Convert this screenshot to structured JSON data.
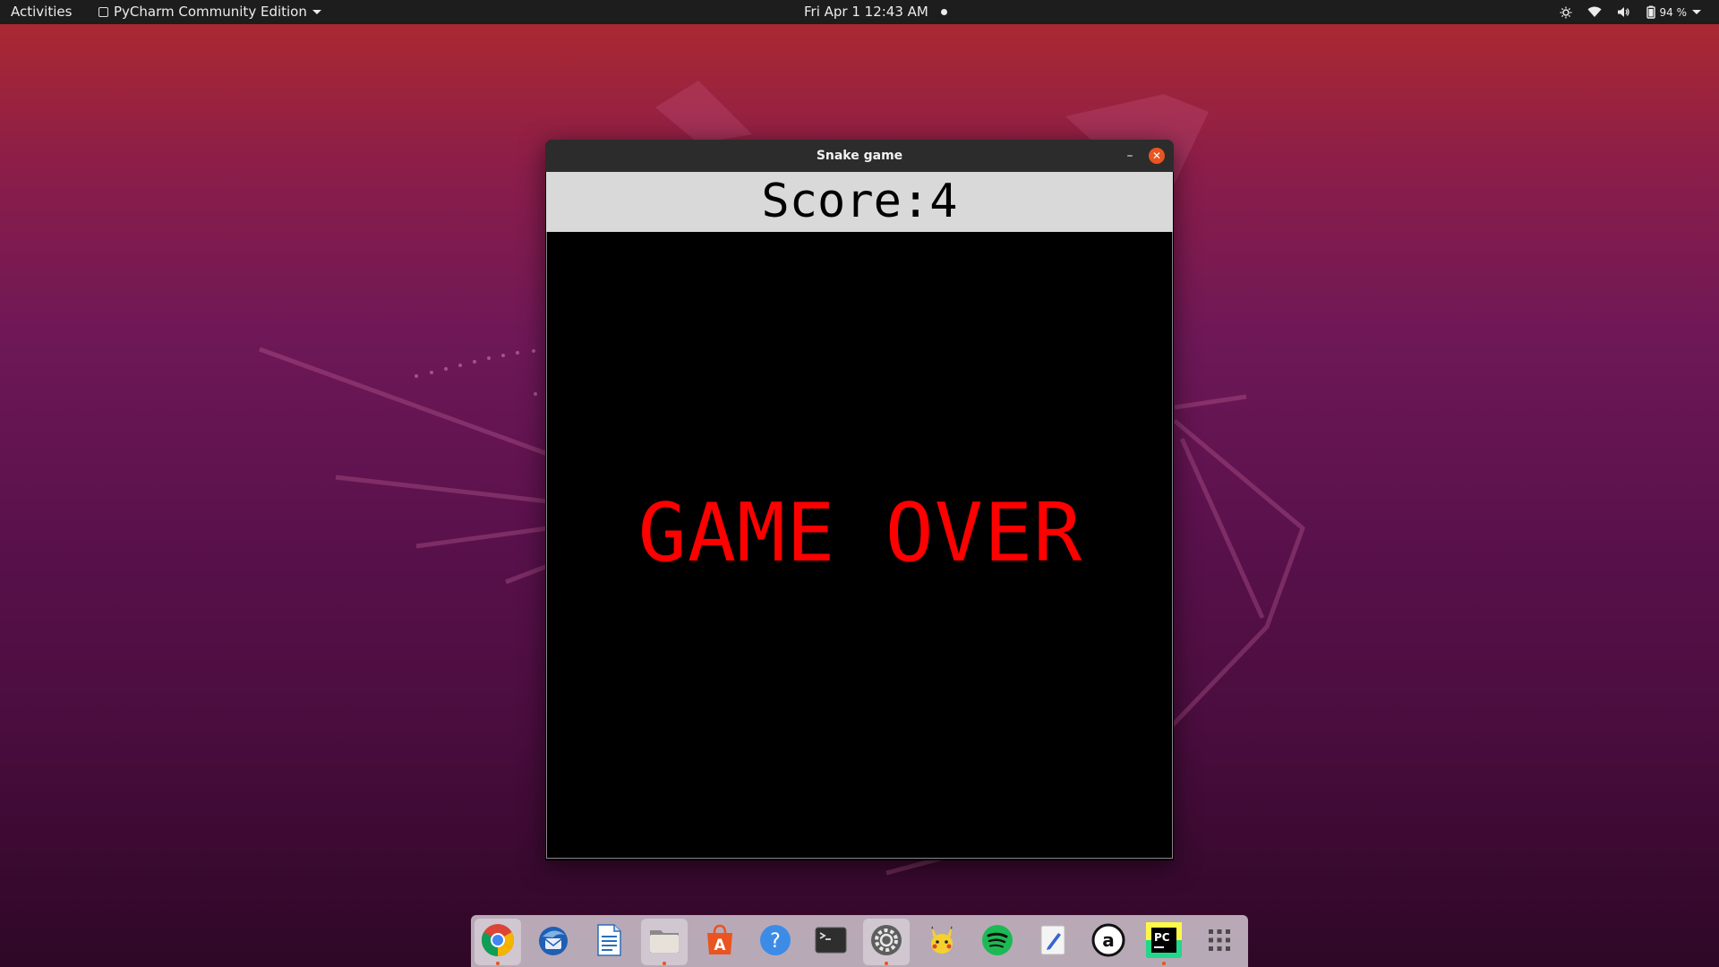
{
  "topbar": {
    "activities": "Activities",
    "app_menu": "PyCharm Community Edition",
    "clock": "Fri Apr 1  12:43 AM",
    "battery_percent": "94 %"
  },
  "window": {
    "title": "Snake game",
    "minimize_label": "–",
    "close_label": "✕"
  },
  "game": {
    "score_text": "Score:4",
    "game_over_text": "GAME OVER",
    "colors": {
      "score_background": "#d9d9d9",
      "canvas_background": "#000000",
      "game_over": "#ff0000"
    }
  },
  "dock": {
    "items": [
      {
        "name": "chrome-icon",
        "running": true,
        "active": true
      },
      {
        "name": "thunderbird-icon",
        "running": false
      },
      {
        "name": "libreoffice-writer-icon",
        "running": false
      },
      {
        "name": "files-icon",
        "running": true,
        "active": true
      },
      {
        "name": "software-center-icon",
        "running": false
      },
      {
        "name": "help-icon",
        "running": false
      },
      {
        "name": "terminal-icon",
        "running": false
      },
      {
        "name": "settings-icon",
        "running": true,
        "active": true
      },
      {
        "name": "pikachu-app-icon",
        "running": false
      },
      {
        "name": "spotify-icon",
        "running": false
      },
      {
        "name": "text-editor-icon",
        "running": false
      },
      {
        "name": "amazon-icon",
        "running": false
      },
      {
        "name": "pycharm-icon",
        "running": true
      },
      {
        "name": "show-applications-icon",
        "running": false
      }
    ]
  },
  "theme": {
    "accent": "#e95420",
    "topbar_bg": "#1d1d1d"
  }
}
